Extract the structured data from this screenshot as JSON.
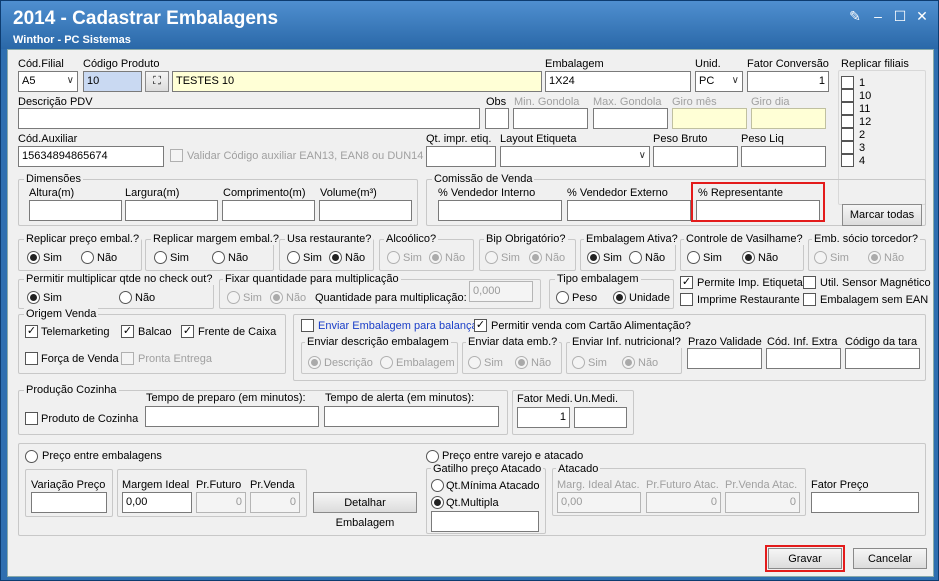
{
  "window": {
    "title": "2014 - Cadastrar Embalagens",
    "subtitle": "Winthor - PC Sistemas"
  },
  "labels": {
    "cod_filial": "Cód.Filial",
    "cod_produto": "Código Produto",
    "embalagem": "Embalagem",
    "unid": "Unid.",
    "fator_conversao": "Fator Conversão",
    "replicar_filiais": "Replicar filiais",
    "descricao_pdv": "Descrição PDV",
    "obs": "Obs",
    "min_gondola": "Min. Gondola",
    "max_gondola": "Max. Gondola",
    "giro_mes": "Giro mês",
    "giro_dia": "Giro dia",
    "cod_auxiliar": "Cód.Auxiliar",
    "validar_ean": "Validar Código auxiliar EAN13, EAN8 ou DUN14",
    "qt_impr": "Qt. impr. etiq.",
    "layout_etiqueta": "Layout Etiqueta",
    "peso_bruto": "Peso Bruto",
    "peso_liq": "Peso Liq",
    "dimensoes": "Dimensões",
    "altura": "Altura(m)",
    "largura": "Largura(m)",
    "comprimento": "Comprimento(m)",
    "volume": "Volume(m³)",
    "comissao": "Comissão de Venda",
    "vend_interno": "% Vendedor Interno",
    "vend_externo": "% Vendedor Externo",
    "representante": "% Representante",
    "sim": "Sim",
    "nao": "Não",
    "replicar_preco": "Replicar preço embal.?",
    "replicar_margem": "Replicar margem embal.?",
    "usa_restaurante": "Usa restaurante?",
    "alcoolico": "Alcoólico?",
    "bip": "Bip Obrigatório?",
    "emb_ativa": "Embalagem Ativa?",
    "vasilhame": "Controle de Vasilhame?",
    "socio": "Emb. sócio torcedor?",
    "multiplicar": "Permitir multiplicar qtde no check out?",
    "fixar_qtd": "Fixar quantidade para multiplicação",
    "qtd_mult": "Quantidade para multiplicação:",
    "tipo_emb": "Tipo embalagem",
    "peso": "Peso",
    "unidade": "Unidade",
    "permite_impr": "Permite Imp. Etiqueta",
    "util_sensor": "Util. Sensor Magnético",
    "imprime_rest": "Imprime Restaurante",
    "emb_sem_ean": "Embalagem sem EAN",
    "origem_venda": "Origem Venda",
    "telemarketing": "Telemarketing",
    "balcao": "Balcao",
    "frente_caixa": "Frente de Caixa",
    "forca_venda": "Força de Venda",
    "pronta_entrega": "Pronta Entrega",
    "enviar_emb_balanca": "Enviar Embalagem para balança",
    "permitir_cartao": "Permitir venda com Cartão Alimentação?",
    "enviar_descr": "Enviar descrição embalagem",
    "descricao": "Descrição",
    "embalagem_opt": "Embalagem",
    "enviar_data": "Enviar data emb.?",
    "enviar_inf": "Enviar Inf. nutricional?",
    "prazo_validade": "Prazo Validade",
    "cod_inf_extra": "Cód. Inf. Extra",
    "codigo_tara": "Código da tara",
    "producao_cozinha": "Produção Cozinha",
    "produto_cozinha": "Produto de Cozinha",
    "tempo_preparo": "Tempo de preparo (em minutos):",
    "tempo_alerta": "Tempo de alerta (em minutos):",
    "fator_medi": "Fator Medi.",
    "un_medi": "Un.Medi.",
    "preco_entre_emb": "Preço entre embalagens",
    "preco_varejo": "Preço entre varejo e atacado",
    "variacao_preco": "Variação Preço",
    "margem_ideal": "Margem Ideal",
    "pr_futuro": "Pr.Futuro",
    "pr_venda": "Pr.Venda",
    "gatilho": "Gatilho preço Atacado",
    "qt_minima": "Qt.Mínima Atacado",
    "qt_multipla": "Qt.Multipla",
    "atacado": "Atacado",
    "marg_ideal_atac": "Marg. Ideal Atac.",
    "pr_futuro_atac": "Pr.Futuro Atac.",
    "pr_venda_atac": "Pr.Venda Atac.",
    "fator_preco": "Fator Preço"
  },
  "values": {
    "cod_filial": "A5",
    "cod_produto": "10",
    "produto_desc": "TESTES 10",
    "embalagem": "1X24",
    "unid": "PC",
    "fator_conversao": "1",
    "cod_auxiliar": "15634894865674",
    "qtd_mult": "0,000",
    "fator_medi": "1",
    "margem_ideal": "0,00",
    "pr_futuro": "0",
    "pr_venda": "0",
    "marg_ideal_atac": "0,00",
    "pr_futuro_atac": "0",
    "pr_venda_atac": "0"
  },
  "filiais": [
    "1",
    "10",
    "11",
    "12",
    "2",
    "3",
    "4"
  ],
  "buttons": {
    "marcar_todas": "Marcar todas",
    "detalhar": "Detalhar Embalagem",
    "gravar": "Gravar",
    "cancelar": "Cancelar"
  },
  "colors": {
    "highlight": "#e31b1b",
    "title_bar": "#2f6fb0",
    "required_field": "#ffffd6"
  }
}
